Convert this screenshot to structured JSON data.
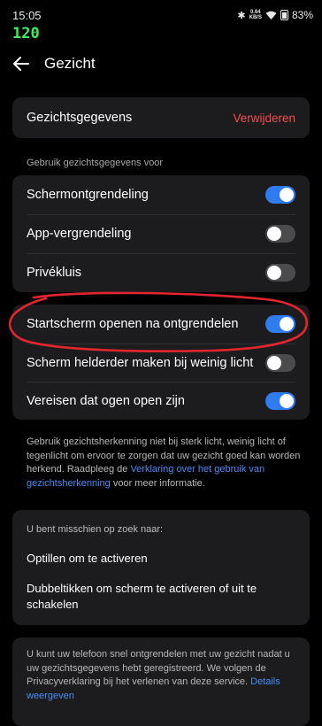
{
  "status_bar": {
    "time": "15:05",
    "net_speed_value": "0.64",
    "net_speed_unit": "KB/S",
    "battery": "83%",
    "fps": "120"
  },
  "header": {
    "title": "Gezicht"
  },
  "face_data": {
    "label": "Gezichtsgegevens",
    "action": "Verwijderen"
  },
  "section_caption": "Gebruik gezichtsgegevens voor",
  "toggles_group_1": [
    {
      "label": "Schermontgrendeling",
      "on": true
    },
    {
      "label": "App-vergrendeling",
      "on": false
    },
    {
      "label": "Privékluis",
      "on": false
    }
  ],
  "toggles_group_2": [
    {
      "label": "Startscherm openen na ontgrendelen",
      "on": true
    },
    {
      "label": "Scherm helderder maken bij weinig licht",
      "on": false
    },
    {
      "label": "Vereisen dat ogen open zijn",
      "on": true
    }
  ],
  "info": {
    "text_1": "Gebruik gezichtsherkenning niet bij sterk licht, weinig licht of tegenlicht om ervoor te zorgen dat uw gezicht goed kan worden herkend. Raadpleeg de ",
    "link": "Verklaring over het gebruik van gezichtsherkenning",
    "text_2": " voor meer informatie."
  },
  "suggestions": {
    "caption": "U bent misschien op zoek naar:",
    "items": [
      "Optillen om te activeren",
      "Dubbeltikken om scherm te activeren of uit te schakelen"
    ]
  },
  "footer": {
    "text": "U kunt uw telefoon snel ontgrendelen met uw gezicht nadat u uw gezichtsgegevens hebt geregistreerd. We volgen de Privacyverklaring bij het verlenen van deze service. ",
    "link": "Details weergeven"
  },
  "colors": {
    "accent": "#2f7bf0",
    "danger": "#f04d4d",
    "annotation": "#e3262e",
    "card": "#1c1c1e"
  }
}
